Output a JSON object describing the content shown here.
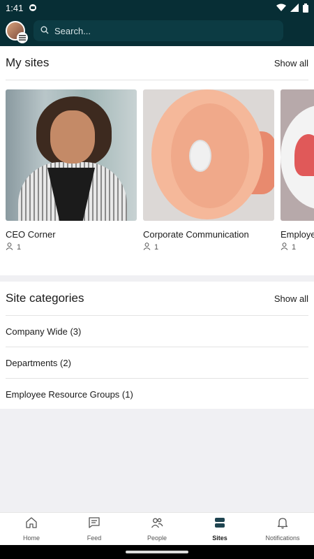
{
  "status_bar": {
    "time": "1:41"
  },
  "search": {
    "placeholder": "Search..."
  },
  "my_sites": {
    "title": "My sites",
    "show_all": "Show all",
    "cards": [
      {
        "name": "CEO Corner",
        "members": "1"
      },
      {
        "name": "Corporate Communication",
        "members": "1"
      },
      {
        "name": "Employee Resource Groups",
        "members": "1"
      }
    ]
  },
  "site_categories": {
    "title": "Site categories",
    "show_all": "Show all",
    "items": [
      {
        "label": "Company Wide (3)"
      },
      {
        "label": "Departments (2)"
      },
      {
        "label": "Employee Resource Groups (1)"
      }
    ]
  },
  "bottom_nav": {
    "items": [
      {
        "label": "Home",
        "icon": "home-icon"
      },
      {
        "label": "Feed",
        "icon": "feed-icon"
      },
      {
        "label": "People",
        "icon": "people-icon"
      },
      {
        "label": "Sites",
        "icon": "sites-icon",
        "active": true
      },
      {
        "label": "Notifications",
        "icon": "bell-icon"
      }
    ]
  },
  "colors": {
    "header_bg": "#072e35",
    "accent_active": "#1b1b1b"
  }
}
